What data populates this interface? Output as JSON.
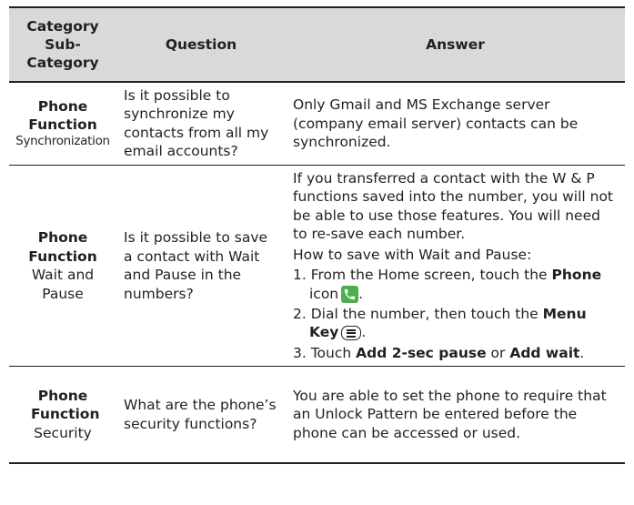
{
  "header": {
    "category": "Category",
    "sub_category": "Sub-Category",
    "question": "Question",
    "answer": "Answer"
  },
  "rows": [
    {
      "category": "Phone Function",
      "sub_category": "Synchronization",
      "question": "Is it possible to synchronize my contacts from all my email accounts?",
      "answer": "Only Gmail and MS Exchange server (company email server) contacts can be synchronized."
    },
    {
      "category": "Phone Function",
      "sub_category": "Wait and Pause",
      "question": "Is it possible to save a contact with Wait and Pause in the numbers?",
      "answer_intro": "If you transferred a contact with the W & P functions saved into the number, you will not be able to use those features. You will need to re-save each number.",
      "answer_howto": "How to save with Wait and Pause:",
      "step1_text": "1. From the Home screen, touch the",
      "step1_bold": "Phone",
      "step1_suffix": "icon",
      "step2_text": "2. Dial the number, then touch the",
      "step2_bold": "Menu Key",
      "step3_text": "3. Touch",
      "step3_bold1": "Add 2-sec pause",
      "step3_or": "or",
      "step3_bold2": "Add wait",
      "period": "."
    },
    {
      "category": "Phone Function",
      "sub_category": "Security",
      "question": "What are the phone’s security functions?",
      "answer": "You are able to set the phone to require that an Unlock Pattern be entered before the phone can be accessed or used."
    }
  ],
  "icons": {
    "phone": "phone-icon",
    "menu": "menu-key-icon",
    "phone_color": "#4caf50"
  }
}
